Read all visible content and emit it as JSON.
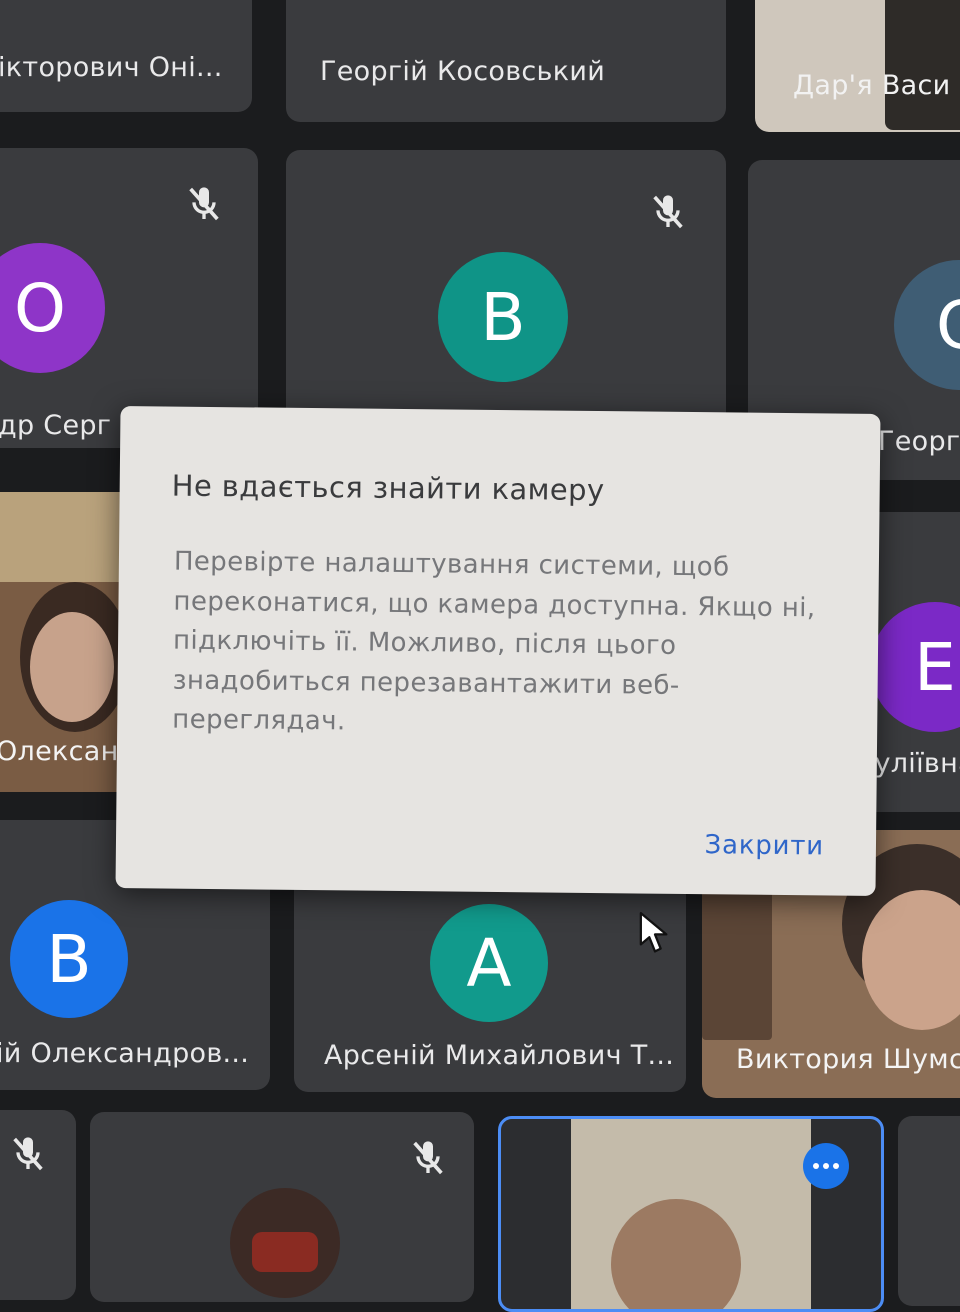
{
  "participants": [
    {
      "name": "ікторович Оні...",
      "mic_off": false
    },
    {
      "name": "Георгій Косовський",
      "mic_off": false
    },
    {
      "name": "Дар'я Васи",
      "mic_off": false
    },
    {
      "name": "др Серг",
      "avatar_letter": "О",
      "avatar_color": "#8e35c8",
      "mic_off": true
    },
    {
      "name": "",
      "avatar_letter": "В",
      "avatar_color": "#0f9487",
      "mic_off": true
    },
    {
      "name": "Георгі",
      "avatar_letter": "С",
      "avatar_color": "#3f5d74",
      "mic_off": false
    },
    {
      "name": "Олександ",
      "mic_off": false
    },
    {
      "name": "ізуліївна",
      "avatar_letter": "Е",
      "avatar_color": "#7b29c6",
      "mic_off": false
    },
    {
      "name": "ій Олександров...",
      "avatar_letter": "В",
      "avatar_color": "#1a73e8",
      "mic_off": false
    },
    {
      "name": "Арсеній Михайлович Т...",
      "avatar_letter": "А",
      "avatar_color": "#119a8c",
      "mic_off": false
    },
    {
      "name": "Виктория Шумска",
      "mic_off": false
    },
    {
      "name": "",
      "mic_off": true
    },
    {
      "name": "",
      "mic_off": true
    },
    {
      "name": "",
      "mic_off": false,
      "more_options": true
    }
  ],
  "dialog": {
    "title": "Не вдається знайти камеру",
    "body": "Перевірте налаштування системи, щоб переконатися, що камера доступна. Якщо ні, підключіть її. Можливо, після цього знадобиться перезавантажити веб-переглядач.",
    "close_label": "Закрити",
    "accent_color": "#2f66c9"
  },
  "icons": {
    "mic_off": "mic-off-icon",
    "more": "more-options-icon",
    "cursor": "mouse-cursor-icon"
  }
}
